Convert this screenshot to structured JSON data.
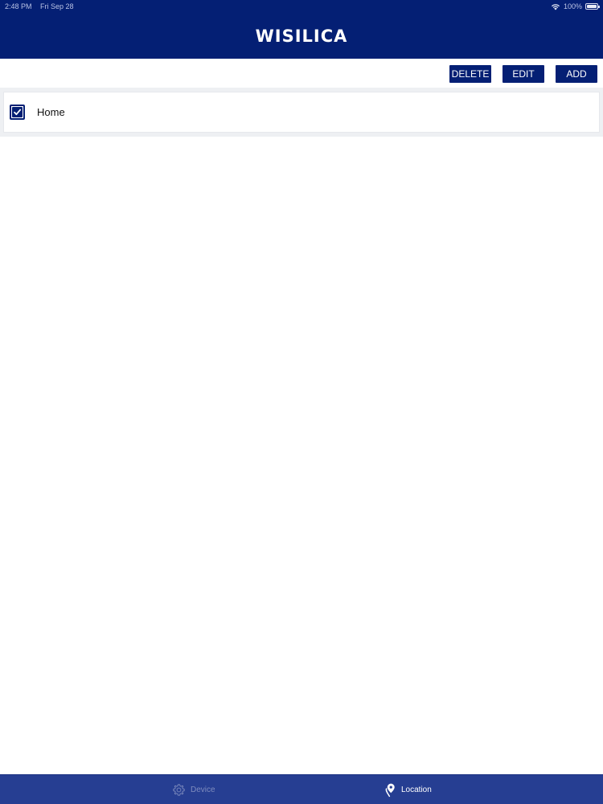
{
  "status_bar": {
    "time": "2:48 PM",
    "date": "Fri Sep 28",
    "battery": "100%"
  },
  "header": {
    "logo_text": "WISILICA"
  },
  "toolbar": {
    "delete_label": "DELETE",
    "edit_label": "EDIT",
    "add_label": "ADD"
  },
  "locations": [
    {
      "label": "Home",
      "checked": true
    }
  ],
  "tab_bar": {
    "tabs": [
      {
        "label": "Device",
        "icon": "gear-icon",
        "active": false
      },
      {
        "label": "Location",
        "icon": "location-pin-icon",
        "active": true
      }
    ]
  },
  "colors": {
    "primary": "#041f74",
    "tab_bar": "#263e92",
    "inactive_tab": "#7f8cbe"
  }
}
